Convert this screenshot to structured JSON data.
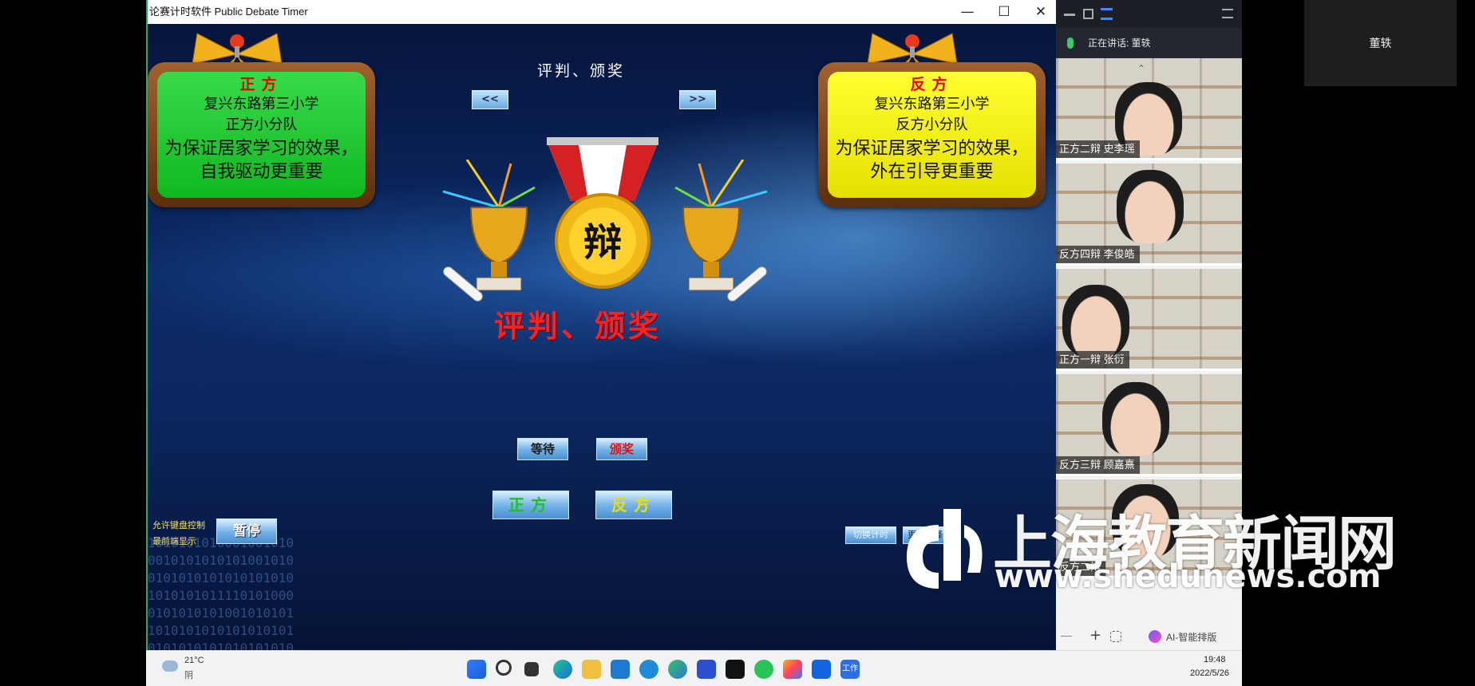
{
  "window": {
    "title": "论赛计时软件 Public Debate Timer",
    "minimize": "—",
    "maximize": "☐",
    "close": "✕"
  },
  "stage": {
    "title": "评判、颁奖",
    "prev": "<<",
    "next": ">>",
    "big_title": "评判、颁奖",
    "medal_char": "辩"
  },
  "pro_board": {
    "side": "正方",
    "school": "复兴东路第三小学",
    "team": "正方小分队",
    "topic": "为保证居家学习的效果，自我驱动更重要"
  },
  "con_board": {
    "side": "反方",
    "school": "复兴东路第三小学",
    "team": "反方小分队",
    "topic": "为保证居家学习的效果，外在引导更重要"
  },
  "controls": {
    "wait": "等待",
    "award": "颁奖",
    "pro": "正方",
    "con": "反方",
    "pause": "暂停",
    "allow_keyboard": "允许键盘控制",
    "topmost": "最前端显示",
    "switch_timer": "切换计时",
    "more": "更多选择",
    "colors": {
      "wait_text": "#1a1a1a",
      "award_text": "#e01010",
      "pro_text": "#20c020",
      "con_text": "#e8e000"
    }
  },
  "meeting": {
    "speaking_label": "正在讲话: 董轶",
    "participants": [
      {
        "label": "正方二辩 史李瑶"
      },
      {
        "label": "反方四辩  李俊皓"
      },
      {
        "label": "正方一辩 张衍"
      },
      {
        "label": "反方三辩 顾嘉熹"
      },
      {
        "label": "反方二辩"
      }
    ],
    "ai_label": "AI-智能排版",
    "plus": "+"
  },
  "right_video": {
    "name": "董轶"
  },
  "taskbar": {
    "weather_temp": "21°C",
    "weather_desc": "阴",
    "time": "19:48",
    "date": "2022/5/26",
    "work_label": "工作",
    "icons": [
      "windows-start-icon",
      "search-icon",
      "task-view-icon",
      "edge-icon",
      "file-explorer-icon",
      "mail-icon",
      "ie-icon",
      "globe-icon",
      "store-icon",
      "capcut-icon",
      "wechat-icon",
      "colorful-app-icon",
      "meeting-app-icon",
      "work-app-icon"
    ]
  },
  "watermark": {
    "cn": "上海教育新闻网",
    "url": "www.shedunews.com"
  }
}
